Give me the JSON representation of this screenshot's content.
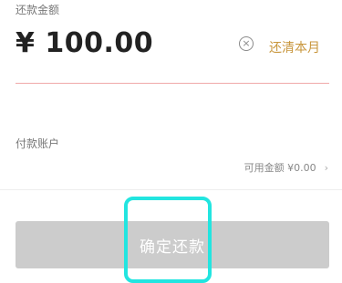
{
  "amount_section": {
    "label": "还款金额",
    "amount": "¥ 100.00",
    "clear_icon": "close-circle-icon",
    "repay_month_label": "还清本月"
  },
  "payment": {
    "label": "付款账户",
    "available": "可用金额 ¥0.00",
    "chevron": "›"
  },
  "confirm_button": {
    "label": "确定还款"
  },
  "colors": {
    "accent": "#c8963c",
    "highlight": "#22e5e0",
    "button_disabled": "#cccccc",
    "error_line": "#f0a8a8"
  }
}
